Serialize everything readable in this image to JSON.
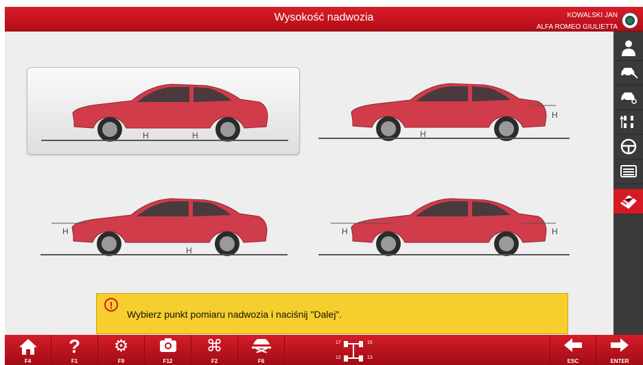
{
  "header": {
    "title": "Wysokość nadwozia",
    "user_name": "KOWALSKI JAN",
    "vehicle": "ALFA ROMEO GIULIETTA"
  },
  "panels": [
    {
      "id": "rear-ground",
      "labels": [
        "H",
        "H"
      ],
      "selected": true
    },
    {
      "id": "rear-wheelarch",
      "labels": [
        "H",
        "H"
      ],
      "selected": false
    },
    {
      "id": "front-wheelarch",
      "labels": [
        "H",
        "H"
      ],
      "selected": false
    },
    {
      "id": "both-wheelarch",
      "labels": [
        "H",
        "H"
      ],
      "selected": false
    }
  ],
  "message": {
    "text": "Wybierz punkt pomiaru nadwozia i naciśnij \"Dalej\"."
  },
  "sidebar": {
    "items": [
      {
        "icon": "technician-icon"
      },
      {
        "icon": "car-wrench-icon"
      },
      {
        "icon": "car-search-icon"
      },
      {
        "icon": "axle-adjust-icon"
      },
      {
        "icon": "steering-wheel-icon"
      },
      {
        "icon": "keyboard-icon"
      },
      {
        "icon": "checkered-flag-icon",
        "active": true
      }
    ]
  },
  "footer": {
    "buttons": [
      {
        "key": "F4",
        "icon": "home-icon"
      },
      {
        "key": "F1",
        "icon": "help-icon"
      },
      {
        "key": "F9",
        "icon": "settings-icon"
      },
      {
        "key": "F12",
        "icon": "camera-icon"
      },
      {
        "key": "F2",
        "icon": "command-icon"
      },
      {
        "key": "F6",
        "icon": "lift-icon"
      }
    ],
    "axle_numbers": [
      "17",
      "15",
      "12",
      "13"
    ],
    "esc_label": "ESC",
    "enter_label": "ENTER"
  },
  "colors": {
    "accent_red": "#d51a26",
    "message_yellow": "#f6cf2e",
    "sidebar_dark": "#3a3a3a",
    "car_red": "#d13c4a"
  }
}
